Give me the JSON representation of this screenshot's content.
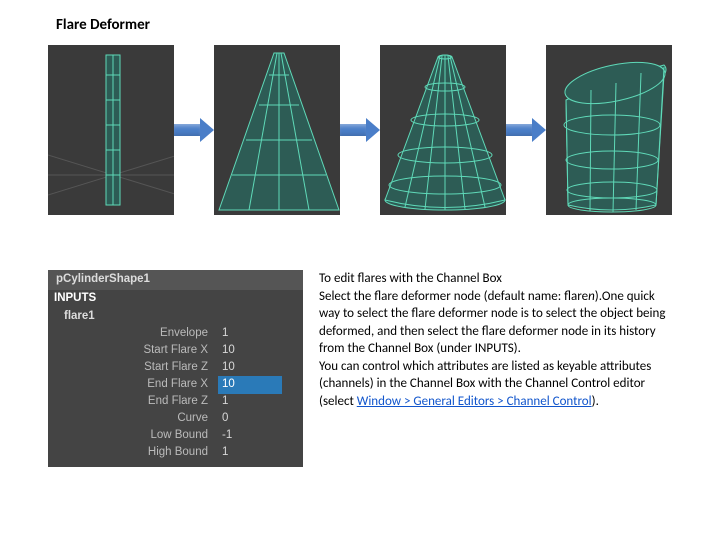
{
  "title": "Flare Deformer",
  "panel": {
    "shape": "pCylinderShape1",
    "inputs_label": "INPUTS",
    "node": "flare1",
    "attributes": [
      {
        "label": "Envelope",
        "value": "1"
      },
      {
        "label": "Start Flare X",
        "value": "10"
      },
      {
        "label": "Start Flare Z",
        "value": "10"
      },
      {
        "label": "End Flare X",
        "value": "10",
        "selected": true
      },
      {
        "label": "End Flare Z",
        "value": "1"
      },
      {
        "label": "Curve",
        "value": "0"
      },
      {
        "label": "Low Bound",
        "value": "-1"
      },
      {
        "label": "High Bound",
        "value": "1"
      }
    ]
  },
  "doc": {
    "p1a": "To edit flares with the Channel Box",
    "p1b": "Select the flare deformer node (default name: flare",
    "p1b_ital": "n",
    "p1c": ").One quick way to select the flare deformer node is to select the object being deformed, and then select the flare deformer node in its history from the Channel Box (under INPUTS).",
    "p2a": "You can control which attributes are listed as keyable attributes (channels) in the Channel Box with the Channel Control editor (select ",
    "link": "Window > General Editors > Channel Control",
    "p2b": ")."
  }
}
